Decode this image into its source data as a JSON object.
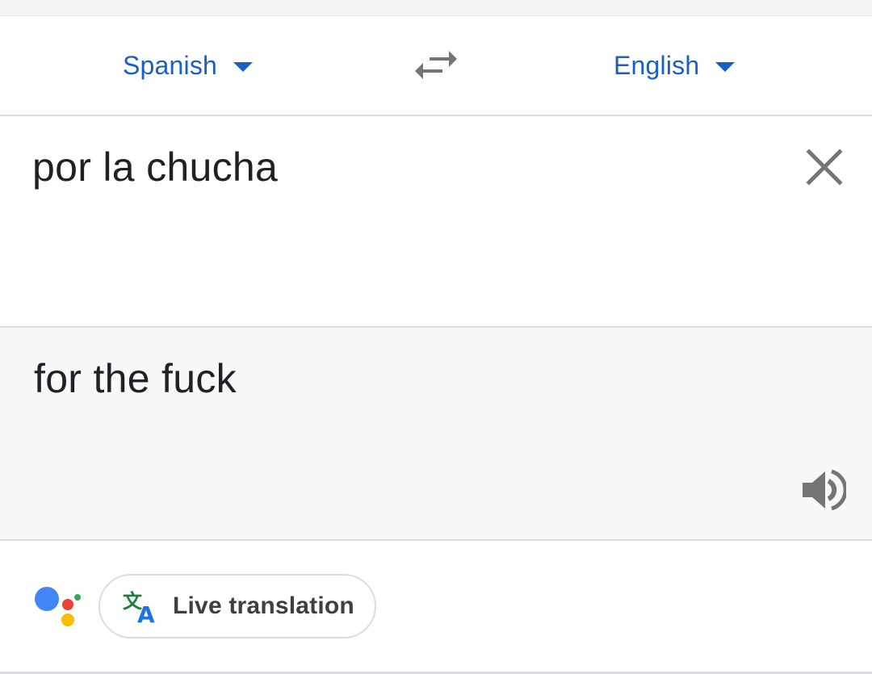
{
  "language_bar": {
    "source_language": "Spanish",
    "target_language": "English",
    "swap_icon": "swap-arrows-icon"
  },
  "source": {
    "text": "por la chucha",
    "icons": [
      "close-icon",
      "speaker-icon",
      "camera-icon"
    ]
  },
  "translation": {
    "text": "for the fuck",
    "icons": [
      "speaker-icon"
    ]
  },
  "assistant": {
    "logo": "google-assistant-icon",
    "chip_label": "Live translation",
    "chip_icon": "translate-icon"
  },
  "colors": {
    "accent": "#1a5fc7",
    "icon_gray": "#757575",
    "text": "#202124",
    "translation_bg": "#f7f8fa",
    "divider": "#dadce0"
  }
}
